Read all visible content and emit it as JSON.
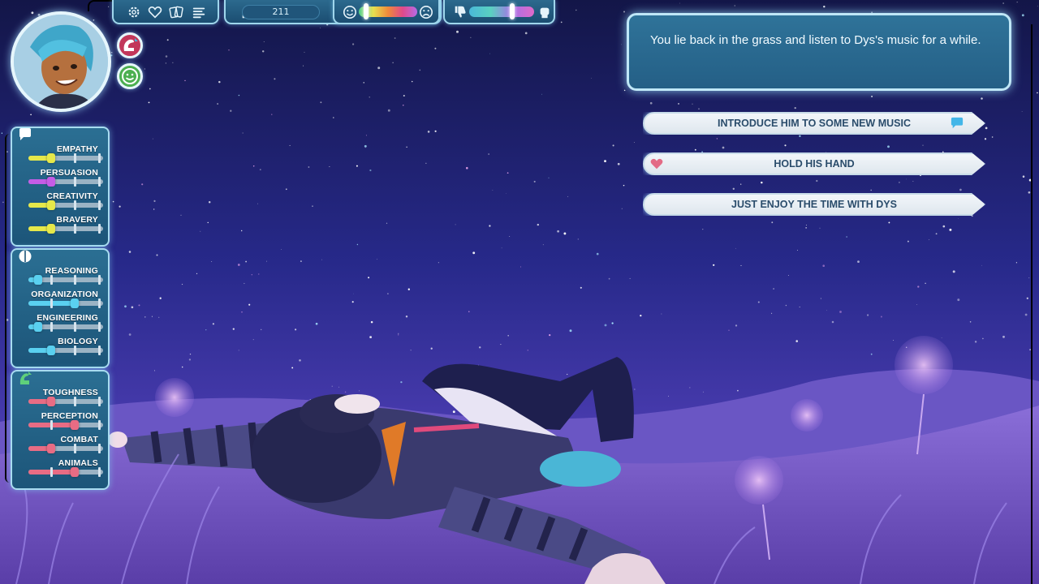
{
  "scene": {
    "background": "starry-night-meadow",
    "characters": [
      "dys-lying-in-grass",
      "player-arm"
    ]
  },
  "topbar": {
    "settings_icon": "gear-icon",
    "favorites_icon": "heart-icon",
    "cards_icon": "cards-icon",
    "log_icon": "list-icon",
    "likes_icon": "thumbs-up-icon",
    "likes_count": "211",
    "mood_meter": {
      "left_icon": "happy-face-icon",
      "right_icon": "sad-face-icon",
      "level": 0.08
    },
    "opinion_meter": {
      "left_icon": "thumbs-down-icon",
      "right_icon": "fist-icon",
      "level": 0.62
    }
  },
  "portrait": {
    "character": "blue-haired-companion-avatar",
    "buttons": [
      {
        "icon": "strength-arm-icon",
        "color": "#c2375a"
      },
      {
        "icon": "smile-icon",
        "color": "#4caf50"
      }
    ]
  },
  "stats": {
    "social": {
      "icon": "speech-bubble-icon",
      "items": [
        {
          "label": "EMPATHY",
          "value": 0.3,
          "color": "#e6e84a"
        },
        {
          "label": "PERSUASION",
          "value": 0.3,
          "color": "#c55ce6"
        },
        {
          "label": "CREATIVITY",
          "value": 0.3,
          "color": "#e6e84a"
        },
        {
          "label": "BRAVERY",
          "value": 0.3,
          "color": "#e6e84a"
        }
      ]
    },
    "mind": {
      "icon": "brain-icon",
      "items": [
        {
          "label": "REASONING",
          "value": 0.13,
          "color": "#5ad0f0"
        },
        {
          "label": "ORGANIZATION",
          "value": 0.62,
          "color": "#5ad0f0"
        },
        {
          "label": "ENGINEERING",
          "value": 0.13,
          "color": "#5ad0f0"
        },
        {
          "label": "BIOLOGY",
          "value": 0.3,
          "color": "#5ad0f0"
        }
      ]
    },
    "body": {
      "icon": "arm-up-icon",
      "items": [
        {
          "label": "TOUGHNESS",
          "value": 0.3,
          "color": "#e86c84"
        },
        {
          "label": "PERCEPTION",
          "value": 0.62,
          "color": "#e86c84"
        },
        {
          "label": "COMBAT",
          "value": 0.3,
          "color": "#e86c84"
        },
        {
          "label": "ANIMALS",
          "value": 0.62,
          "color": "#e86c84"
        }
      ]
    }
  },
  "dialogue": {
    "narration": "You lie back in the grass and listen to Dys's music for a while.",
    "choices": [
      {
        "label": "INTRODUCE HIM TO SOME NEW MUSIC",
        "icon": "speech-bubble-icon",
        "icon_side": "right",
        "icon_color": "#43b6e8"
      },
      {
        "label": "HOLD HIS HAND",
        "icon": "heart-icon",
        "icon_side": "left",
        "icon_color": "#e36b86"
      },
      {
        "label": "JUST ENJOY THE TIME WITH DYS",
        "icon": "",
        "icon_side": "none",
        "icon_color": ""
      }
    ]
  }
}
